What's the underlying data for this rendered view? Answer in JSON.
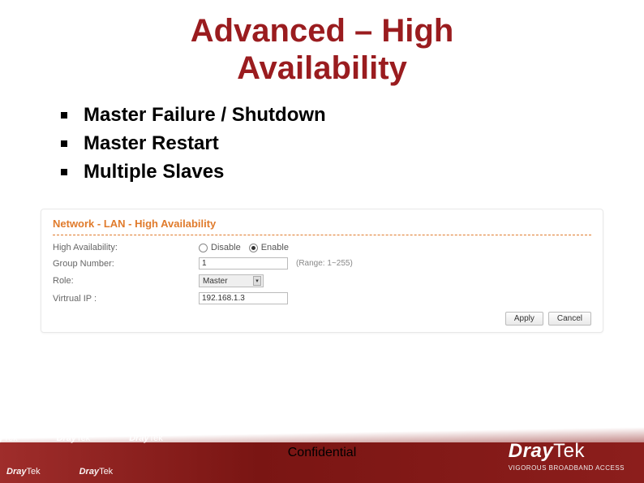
{
  "title_line1": "Advanced – High",
  "title_line2": "Availability",
  "bullets": {
    "item1": "Master Failure / Shutdown",
    "item2": "Master Restart",
    "item3": "Multiple Slaves"
  },
  "panel": {
    "header": "Network - LAN - High Availability",
    "fields": {
      "ha_label": "High Availability:",
      "disable_label": "Disable",
      "enable_label": "Enable",
      "group_label": "Group Number:",
      "group_value": "1",
      "group_range": "(Range: 1~255)",
      "role_label": "Role:",
      "role_value": "Master",
      "vip_label": "Virtrual IP :",
      "vip_value": "192.168.1.3"
    },
    "buttons": {
      "apply": "Apply",
      "cancel": "Cancel"
    }
  },
  "footer": {
    "confidential": "Confidential",
    "brand_dray": "Dray",
    "brand_tek": "Tek",
    "tagline": "VIGOROUS BROADBAND ACCESS"
  }
}
